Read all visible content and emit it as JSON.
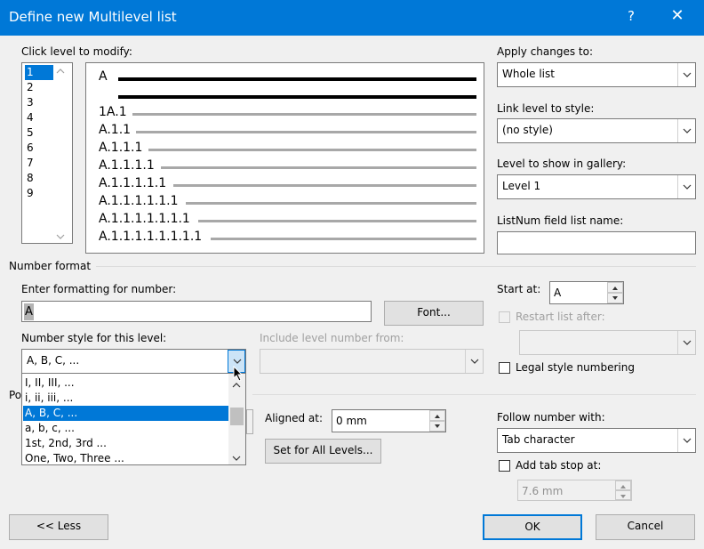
{
  "window": {
    "title": "Define new Multilevel list",
    "help": "?",
    "close": "✕"
  },
  "level_list": {
    "label": "Click level to modify:",
    "items": [
      "1",
      "2",
      "3",
      "4",
      "5",
      "6",
      "7",
      "8",
      "9"
    ],
    "selected": "1"
  },
  "preview": {
    "lines": [
      "A",
      "1A.1",
      "A.1.1",
      "A.1.1.1",
      "A.1.1.1.1",
      "A.1.1.1.1.1",
      "A.1.1.1.1.1.1",
      "A.1.1.1.1.1.1.1",
      "A.1.1.1.1.1.1.1.1"
    ]
  },
  "apply_changes": {
    "label": "Apply changes to:",
    "value": "Whole list"
  },
  "link_level": {
    "label": "Link level to style:",
    "value": "(no style)"
  },
  "gallery_level": {
    "label": "Level to show in gallery:",
    "value": "Level 1"
  },
  "listnum": {
    "label": "ListNum field list name:",
    "value": ""
  },
  "number_format": {
    "section": "Number format",
    "enter_label": "Enter formatting for number:",
    "format_value": "A",
    "font_button": "Font...",
    "style_label": "Number style for this level:",
    "style_value": "A, B, C, ...",
    "include_label": "Include level number from:",
    "include_value": "",
    "start_label": "Start at:",
    "start_value": "A",
    "restart_label": "Restart list after:",
    "restart_value": "",
    "legal_label": "Legal style numbering"
  },
  "style_dropdown": {
    "options": [
      "I, II, III, ...",
      "i, ii, iii, ...",
      "A, B, C, ...",
      "a, b, c, ...",
      "1st, 2nd, 3rd ...",
      "One, Two, Three ..."
    ],
    "selected_index": 2
  },
  "position": {
    "section_partial": "Po",
    "aligned_label": "Aligned at:",
    "aligned_value": "0 mm",
    "set_all_button": "Set for All Levels...",
    "follow_label": "Follow number with:",
    "follow_value": "Tab character",
    "tabstop_label": "Add tab stop at:",
    "tabstop_value": "7.6 mm"
  },
  "footer": {
    "less_button": "<< Less",
    "ok_button": "OK",
    "cancel_button": "Cancel"
  },
  "colors": {
    "accent": "#0078d7",
    "background": "#f0f0f0"
  }
}
